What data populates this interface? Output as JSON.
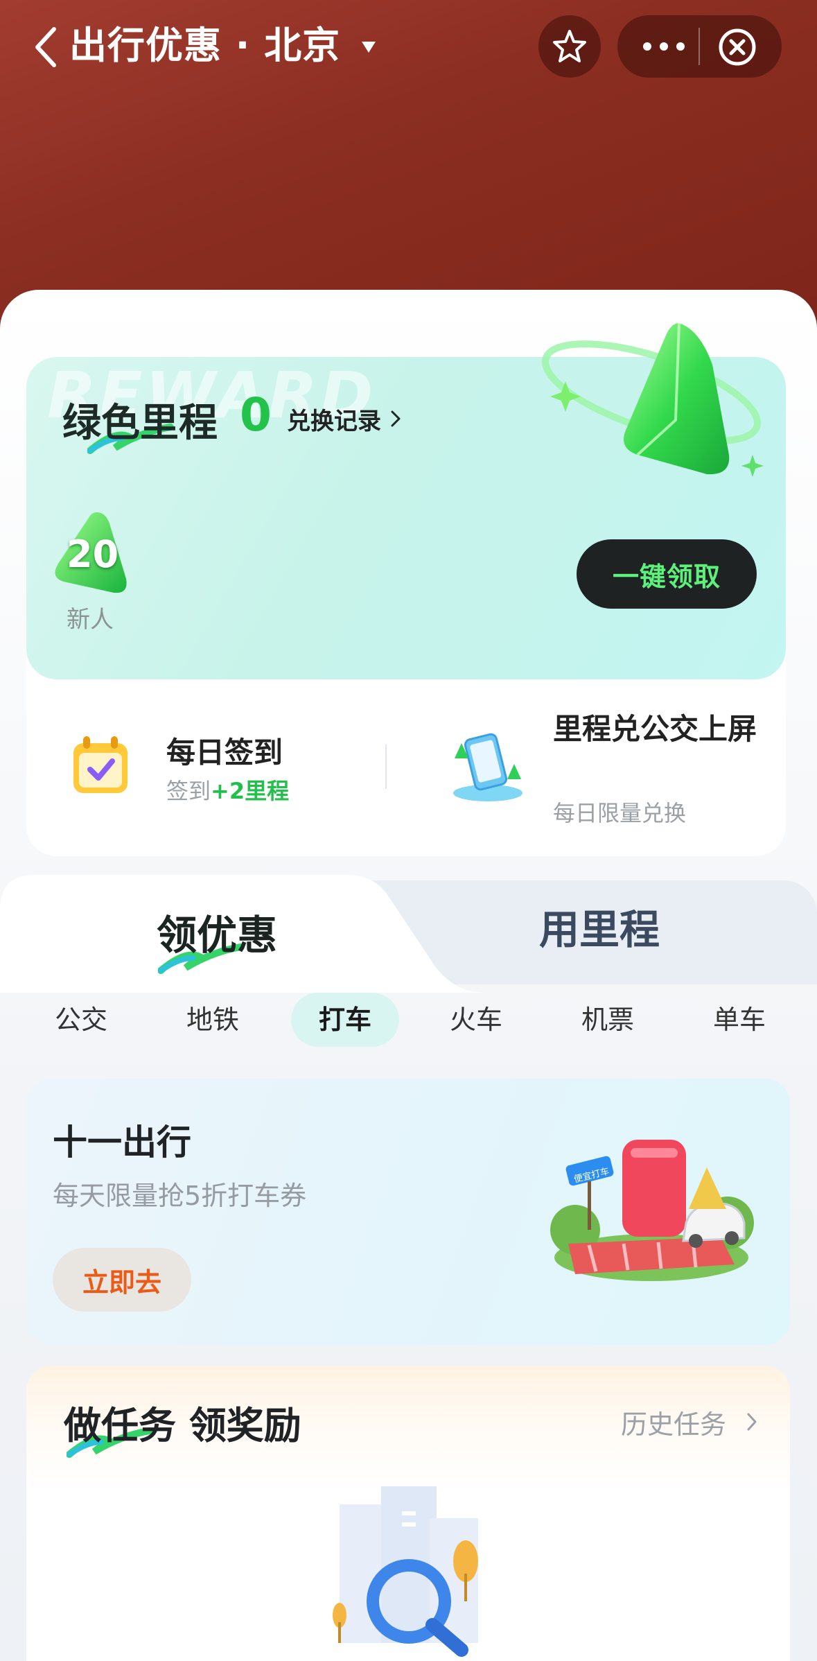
{
  "navbar": {
    "title": "出行优惠 · 北京",
    "back_icon": "chevron-left-icon",
    "dropdown_icon": "caret-down-icon",
    "favorite_icon": "star-icon",
    "more_icon": "more-dots-icon",
    "close_icon": "close-circle-icon"
  },
  "reward": {
    "watermark": "REWARD",
    "title": "绿色里程",
    "count": "0",
    "history_label": "兑换记录",
    "badge_value": "20",
    "badge_label": "新人",
    "claim_button": "一键领取"
  },
  "quick_actions": [
    {
      "title": "每日签到",
      "sub_prefix": "签到",
      "sub_highlight": "+2里程",
      "icon": "calendar-check-icon"
    },
    {
      "title": "里程兑公交上屏",
      "sub": "每日限量兑换",
      "icon": "phone-screen-icon"
    }
  ],
  "main_tabs": [
    {
      "label": "领优惠",
      "active": true
    },
    {
      "label": "用里程",
      "active": false
    }
  ],
  "categories": [
    {
      "label": "公交",
      "active": false
    },
    {
      "label": "地铁",
      "active": false
    },
    {
      "label": "打车",
      "active": true
    },
    {
      "label": "火车",
      "active": false
    },
    {
      "label": "机票",
      "active": false
    },
    {
      "label": "单车",
      "active": false
    }
  ],
  "promo": {
    "title": "十一出行",
    "subtitle": "每天限量抢5折打车券",
    "button": "立即去",
    "art_sign_text": "便宜打车"
  },
  "tasks": {
    "title": "做任务 领奖励",
    "history_label": "历史任务"
  },
  "colors": {
    "header_red": "#8c2e22",
    "accent_green": "#23c24a",
    "claim_text_green": "#5df07c",
    "promo_orange": "#ea5b18"
  }
}
